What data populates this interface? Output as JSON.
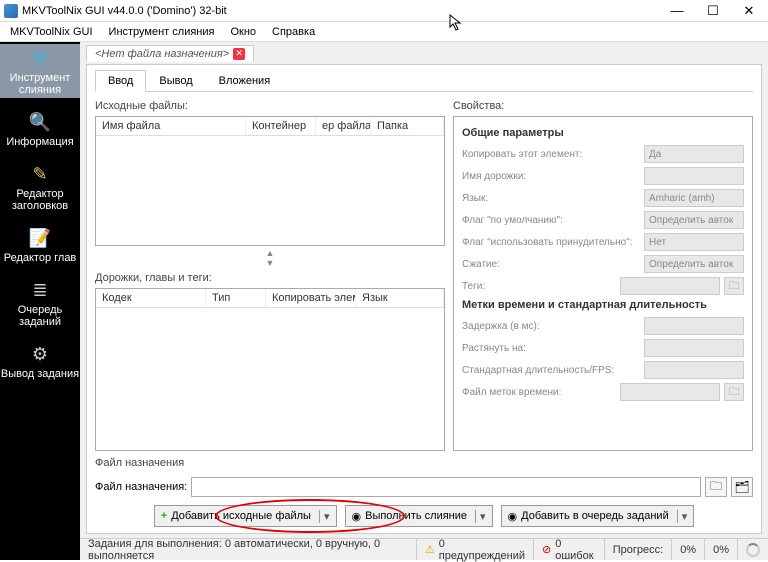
{
  "window": {
    "title": "MKVToolNix GUI v44.0.0 ('Domino') 32-bit"
  },
  "menu": {
    "items": [
      "MKVToolNix GUI",
      "Инструмент слияния",
      "Окно",
      "Справка"
    ]
  },
  "sidebar": {
    "items": [
      {
        "label": "Инструмент слияния"
      },
      {
        "label": "Информация"
      },
      {
        "label": "Редактор заголовков"
      },
      {
        "label": "Редактор глав"
      },
      {
        "label": "Очередь заданий"
      },
      {
        "label": "Вывод задания"
      }
    ]
  },
  "filetab": {
    "label": "<Нет файла назначения>"
  },
  "tabs": {
    "t0": "Ввод",
    "t1": "Вывод",
    "t2": "Вложения"
  },
  "left": {
    "sourceLabel": "Исходные файлы:",
    "srcCols": {
      "c0": "Имя файла",
      "c1": "Контейнер",
      "c2": "ер файла",
      "c3": "Папка"
    },
    "tracksLabel": "Дорожки, главы и теги:",
    "trkCols": {
      "c0": "Кодек",
      "c1": "Тип",
      "c2": "Копировать элем",
      "c3": "Язык"
    }
  },
  "right": {
    "title": "Свойства:",
    "group1": "Общие параметры",
    "rows": {
      "copy": {
        "lbl": "Копировать этот элемент:",
        "val": "Да"
      },
      "trackName": {
        "lbl": "Имя дорожки:",
        "val": ""
      },
      "lang": {
        "lbl": "Язык:",
        "val": "Amharic (amh)"
      },
      "flagDef": {
        "lbl": "Флаг \"по умолчанию\":",
        "val": "Определить авток"
      },
      "flagForce": {
        "lbl": "Флаг \"использовать принудительно\":",
        "val": "Нет"
      },
      "compress": {
        "lbl": "Сжатие:",
        "val": "Определить авток"
      },
      "tags": {
        "lbl": "Теги:",
        "val": ""
      }
    },
    "group2": "Метки времени и стандартная длительность",
    "rows2": {
      "delay": {
        "lbl": "Задержка (в мс):",
        "val": ""
      },
      "stretch": {
        "lbl": "Растянуть на:",
        "val": ""
      },
      "fps": {
        "lbl": "Стандартная длительность/FPS:",
        "val": ""
      },
      "tcfile": {
        "lbl": "Файл меток времени:",
        "val": ""
      }
    }
  },
  "dest": {
    "section": "Файл назначения",
    "label": "Файл назначения:",
    "value": ""
  },
  "actions": {
    "add": "Добавить исходные файлы",
    "run": "Выполнить слияние",
    "queue": "Добавить в очередь заданий"
  },
  "status": {
    "jobs": "Задания для выполнения:  0 автоматически, 0 вручную, 0 выполняется",
    "warn": "0 предупреждений",
    "err": "0 ошибок",
    "progress": "Прогресс:",
    "p1": "0%",
    "p2": "0%"
  }
}
